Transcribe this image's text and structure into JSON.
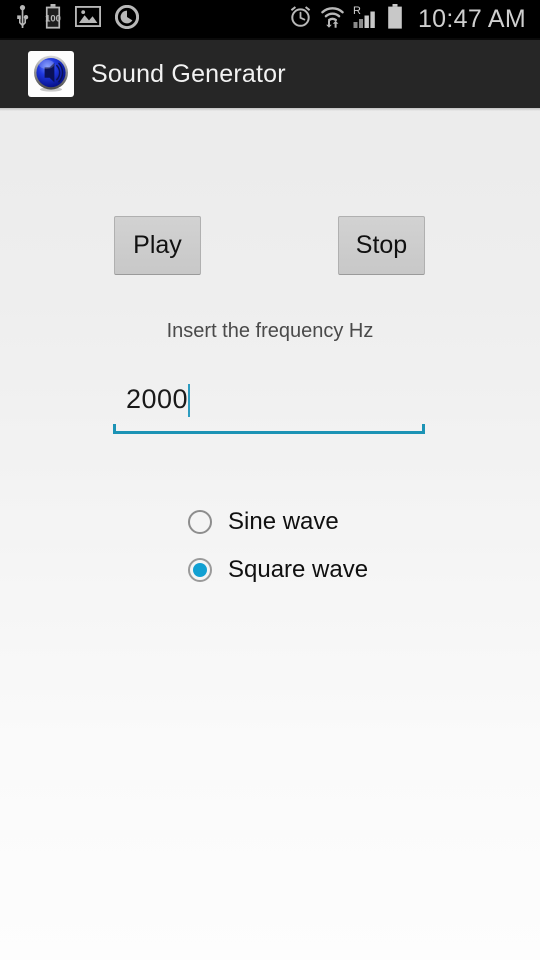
{
  "status_bar": {
    "time": "10:47 AM",
    "battery_level_text": "100",
    "left_icons": [
      {
        "name": "usb-icon"
      },
      {
        "name": "battery-full-icon"
      },
      {
        "name": "image-gallery-icon"
      },
      {
        "name": "app-circle-icon"
      }
    ],
    "right_icons": [
      {
        "name": "alarm-clock-icon"
      },
      {
        "name": "wifi-transfer-icon"
      },
      {
        "name": "roaming-signal-icon",
        "label": "R"
      },
      {
        "name": "battery-status-icon"
      }
    ]
  },
  "action_bar": {
    "title": "Sound Generator",
    "icon": "sound-generator-app-icon"
  },
  "main": {
    "play_button": "Play",
    "stop_button": "Stop",
    "frequency_hint": "Insert the frequency Hz",
    "frequency_value": "2000",
    "frequency_placeholder": "",
    "wave_options": [
      {
        "label": "Sine wave",
        "selected": false
      },
      {
        "label": "Square wave",
        "selected": true
      }
    ]
  },
  "colors": {
    "accent": "#1c93b5",
    "radio_selected": "#12a0d2",
    "action_bar_bg": "#262626",
    "status_bar_bg": "#000000"
  }
}
